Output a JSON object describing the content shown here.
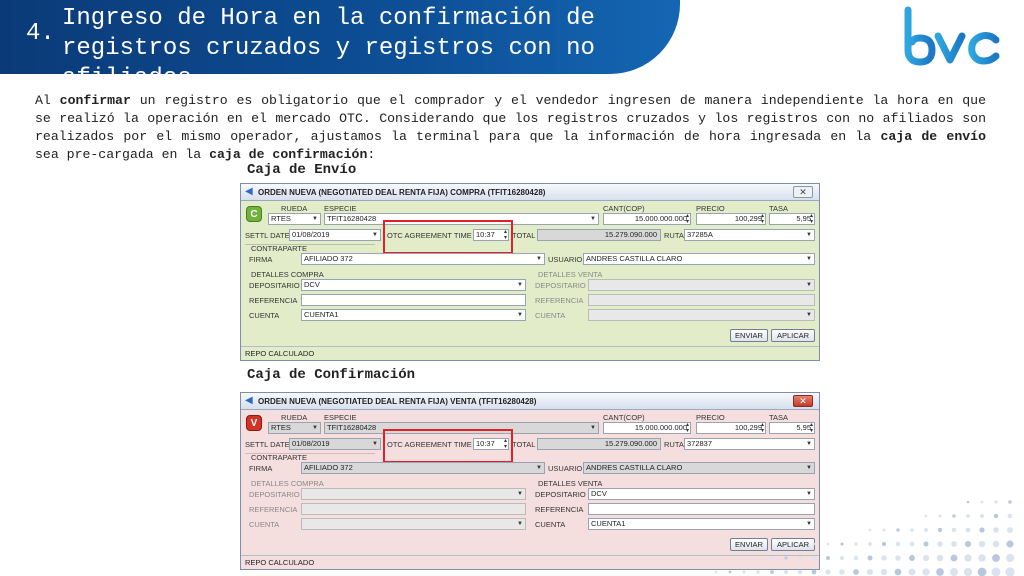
{
  "slide": {
    "number": "4.",
    "title": "Ingreso de Hora en la confirmación de registros cruzados y registros con no afiliados",
    "logo_text": "bvc",
    "paragraph": {
      "p1": "Al ",
      "b1": "confirmar",
      "p2": " un registro es obligatorio que el comprador y el vendedor ingresen de manera independiente la hora en que se realizó la operación en el mercado OTC. Considerando que los registros cruzados y los registros con no afiliados son realizados por el mismo operador, ajustamos la terminal para que la información de hora ingresada en la ",
      "b2": "caja de envío",
      "p3": " sea pre-cargada en la ",
      "b3": "caja de confirmación",
      "p4": ":"
    },
    "caption_send": "Caja de Envío",
    "caption_confirm": "Caja de Confirmación"
  },
  "labels": {
    "rueda": "RUEDA",
    "especie": "ESPECIE",
    "cant": "CANT(COP)",
    "precio": "PRECIO",
    "tasa": "TASA",
    "settl_date": "SETTL DATE",
    "otc_time": "OTC AGREEMENT TIME",
    "total": "TOTAL",
    "ruta": "RUTA",
    "contraparte": "CONTRAPARTE",
    "firma": "FIRMA",
    "usuario": "USUARIO",
    "detalles_compra": "DETALLES COMPRA",
    "detalles_venta": "DETALLES VENTA",
    "depositario": "DEPOSITARIO",
    "referencia": "REFERENCIA",
    "cuenta": "CUENTA",
    "enviar": "ENVIAR",
    "aplicar": "APLICAR",
    "status": "REPO CALCULADO",
    "close": "✕"
  },
  "send_window": {
    "title": "ORDEN NUEVA (NEGOTIATED DEAL RENTA FIJA) COMPRA (TFIT16280428)",
    "badge": "C",
    "rueda": "RTES",
    "especie": "TFIT16280428",
    "cant": "15.000.000.000",
    "precio": "100,299",
    "tasa": "5,95",
    "settl_date": "01/08/2019",
    "otc_time": "10:37",
    "total": "15.279.090.000",
    "ruta": "37285A",
    "firma": "AFILIADO 372",
    "usuario": "ANDRES CASTILLA CLARO",
    "depositario": "DCV",
    "referencia": "",
    "cuenta": "CUENTA1"
  },
  "confirm_window": {
    "title": "ORDEN NUEVA (NEGOTIATED DEAL RENTA FIJA) VENTA (TFIT16280428)",
    "badge": "V",
    "rueda": "RTES",
    "especie": "TFIT16280428",
    "cant": "15.000.000.000",
    "precio": "100,299",
    "tasa": "5,95",
    "settl_date": "01/08/2019",
    "otc_time": "10:37",
    "total": "15.279.090.000",
    "ruta": "372837",
    "firma": "AFILIADO 372",
    "usuario": "ANDRES CASTILLA CLARO",
    "depositario": "DCV",
    "referencia": "",
    "cuenta": "CUENTA1"
  }
}
